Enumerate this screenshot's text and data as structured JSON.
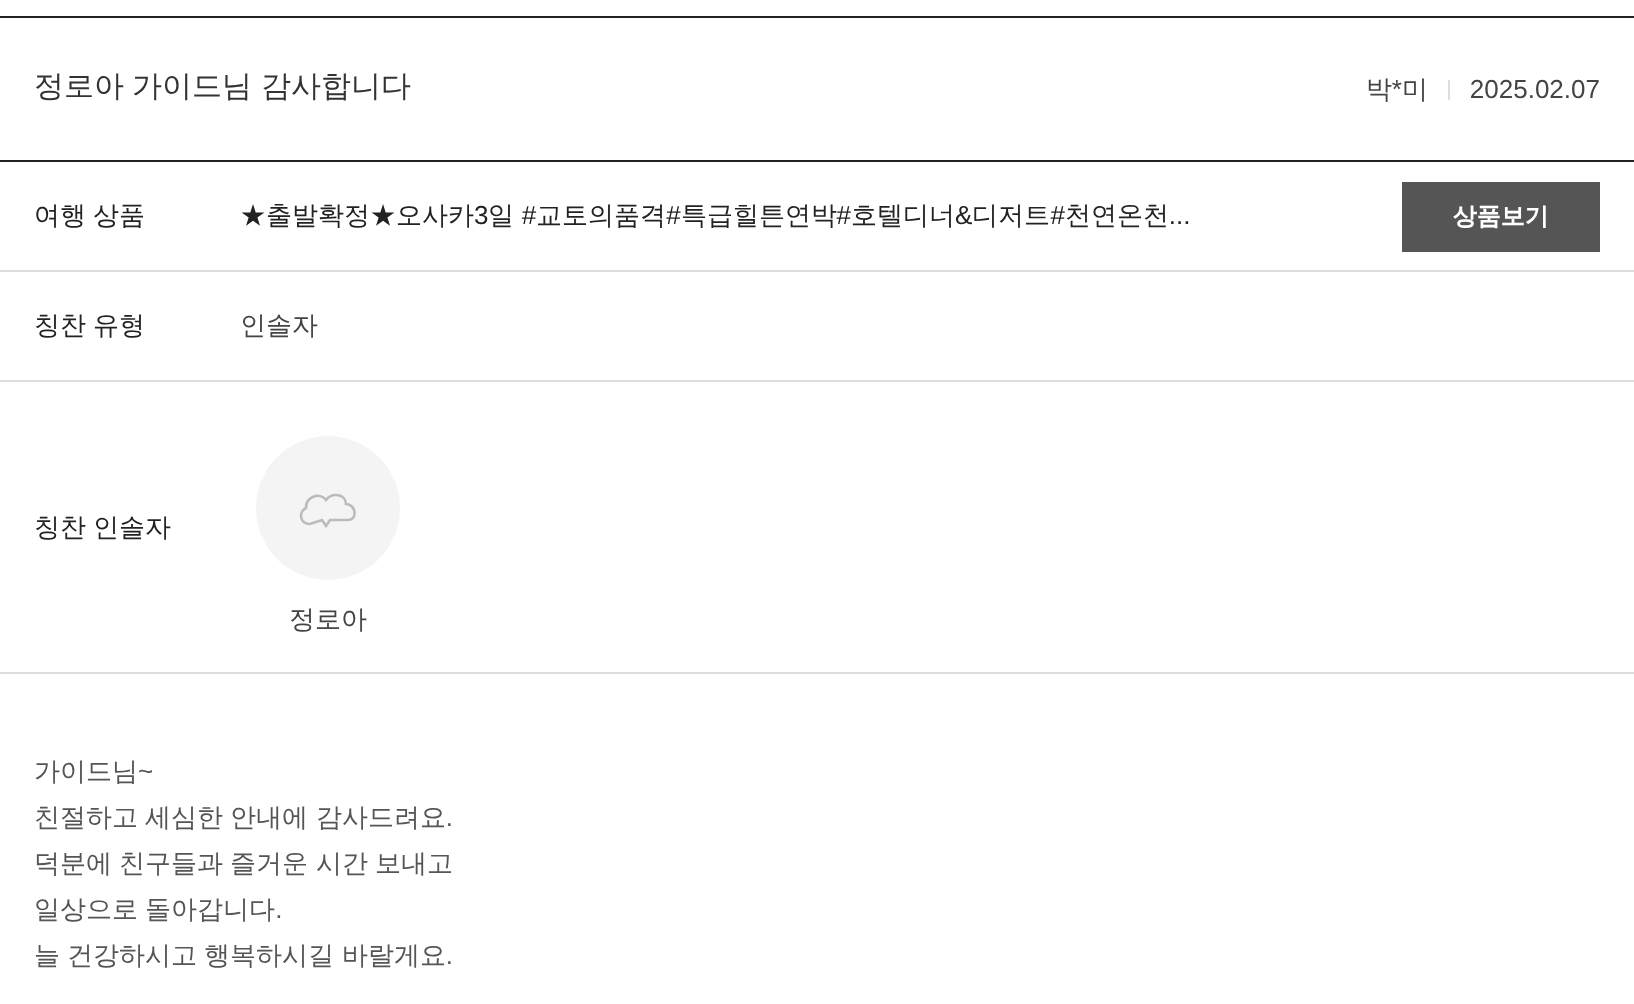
{
  "title": "정로아 가이드님 감사합니다",
  "author": "박*미",
  "date": "2025.02.07",
  "rows": [
    {
      "kind": "product",
      "label": "여행 상품",
      "value": "★출발확정★오사카3일 #교토의품격#특급힐튼연박#호텔디너&디저트#천연온천...",
      "button": "상품보기"
    },
    {
      "kind": "text",
      "label": "칭찬 유형",
      "value": "인솔자"
    },
    {
      "kind": "guide",
      "label": "칭찬 인솔자",
      "name": "정로아"
    }
  ],
  "body": [
    "가이드님~",
    "친절하고 세심한 안내에 감사드려요.",
    "덕분에 친구들과 즐거운 시간 보내고",
    "일상으로 돌아갑니다.",
    "늘 건강하시고 행복하시길 바랄게요."
  ]
}
